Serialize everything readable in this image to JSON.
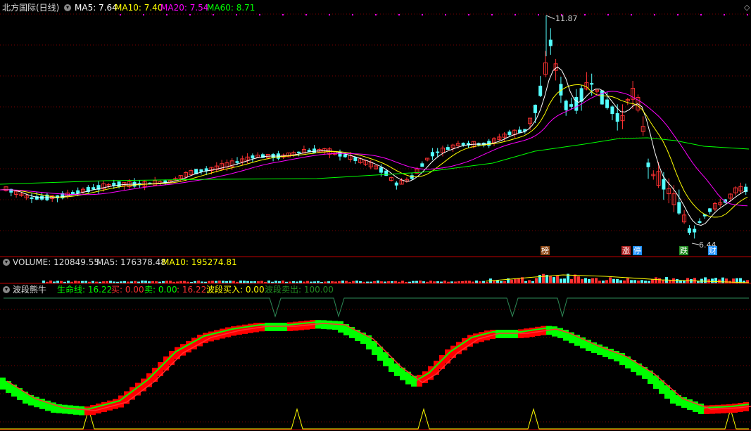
{
  "main": {
    "title": "北方国际(日线)",
    "ma5": "MA5: 7.64",
    "ma10": "MA10: 7.40",
    "ma20": "MA20: 7.54",
    "ma60": "MA60: 8.71",
    "high_label": "11.87",
    "low_label": "6.44",
    "tags": [
      "榜",
      "涨",
      "停",
      "跌",
      "财"
    ]
  },
  "volume": {
    "label": "VOLUME: 120849.55",
    "ma5": "MA5: 176378.48",
    "ma10": "MA10: 195274.81"
  },
  "indicator": {
    "name": "波段熊牛",
    "lifeline": "生命线: 16.22",
    "buy": "买: 0.00",
    "sell": "卖: 0.00",
    "extra": ": 16.22",
    "band_buy": "波段买入: 0.00",
    "band_sell": "波段卖出: 100.00"
  },
  "colors": {
    "up": "#ff3232",
    "down": "#54ffff",
    "ma5": "#ffffff",
    "ma10": "#ffff00",
    "ma20": "#ff00ff",
    "ma60": "#00ff00",
    "grid": "#8b0000"
  }
}
